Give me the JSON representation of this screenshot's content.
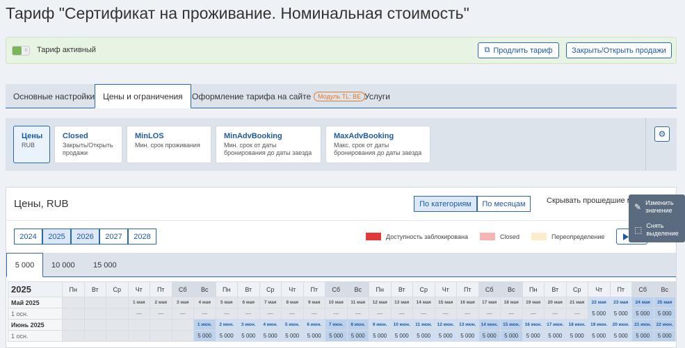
{
  "title": "Тариф \"Сертификат на проживание. Номинальная стоимость\"",
  "status": {
    "toggle_mark": "II",
    "label": "Тариф активный"
  },
  "actions": {
    "extend": "Продлить тариф",
    "close_open": "Закрыть/Открыть продажи"
  },
  "tabs": [
    "Основные настройки",
    "Цены и ограничения",
    "Оформление тарифа на сайте",
    "Услуги"
  ],
  "module_badge": "Модуль TL: BE",
  "subtabs": [
    {
      "h": "Цены",
      "s": "RUB"
    },
    {
      "h": "Closed",
      "s": "Закрыть/Открыть продажи"
    },
    {
      "h": "MinLOS",
      "s": "Мин. срок проживания"
    },
    {
      "h": "MinAdvBooking",
      "s": "Мин. срок от даты бронирования до даты заезда"
    },
    {
      "h": "MaxAdvBooking",
      "s": "Макс. срок от даты бронирования до даты заезда"
    }
  ],
  "panel": {
    "title": "Цены, RUB",
    "by_category": "По категориям",
    "by_month": "По месяцам",
    "hide_past": "Скрывать прошедшие м"
  },
  "years": [
    "2024",
    "2025",
    "2026",
    "2027",
    "2028"
  ],
  "legend": [
    {
      "label": "Доступность заблокирована",
      "color": "#e03a3a"
    },
    {
      "label": "Closed",
      "color": "#f5b5b5"
    },
    {
      "label": "Переопределение",
      "color": "#fbeccc"
    }
  ],
  "occupancy_tabs": [
    "5 000",
    "10 000",
    "15 000"
  ],
  "grid": {
    "year": "2025",
    "weekdays": [
      "Пн",
      "Вт",
      "Ср",
      "Чт",
      "Пт",
      "Сб",
      "Вс",
      "Пн",
      "Вт",
      "Ср",
      "Чт",
      "Пт",
      "Сб",
      "Вс",
      "Пн",
      "Вт",
      "Ср",
      "Чт",
      "Пт",
      "Сб",
      "Вс",
      "Пн",
      "Вт",
      "Ср",
      "Чт",
      "Пт",
      "Сб",
      "Вс"
    ],
    "may_label": "Май 2025",
    "june_label": "Июнь 2025",
    "sub_label": "1 осн.",
    "may_days": [
      "1 мая",
      "2 мая",
      "3 мая",
      "4 мая",
      "5 мая",
      "6 мая",
      "7 мая",
      "8 мая",
      "9 мая",
      "10 мая",
      "11 мая",
      "12 мая",
      "13 мая",
      "14 мая",
      "15 мая",
      "16 мая",
      "17 мая",
      "18 мая",
      "19 мая",
      "20 мая",
      "21 мая",
      "22 мая",
      "23 мая",
      "24 мая",
      "25 мая"
    ],
    "june_days": [
      "1 июн.",
      "2 июн.",
      "3 июн.",
      "4 июн.",
      "5 июн.",
      "6 июн.",
      "7 июн.",
      "8 июн.",
      "9 июн.",
      "10 июн.",
      "11 июн.",
      "12 июн.",
      "13 июн.",
      "14 июн.",
      "15 июн.",
      "16 июн.",
      "17 июн.",
      "18 июн.",
      "19 июн.",
      "20 июн.",
      "21 июн.",
      "22 июн."
    ],
    "dash": "—",
    "price": "5 000"
  },
  "context_menu": {
    "edit": "Изменить значение",
    "clear": "Снять выделение"
  }
}
